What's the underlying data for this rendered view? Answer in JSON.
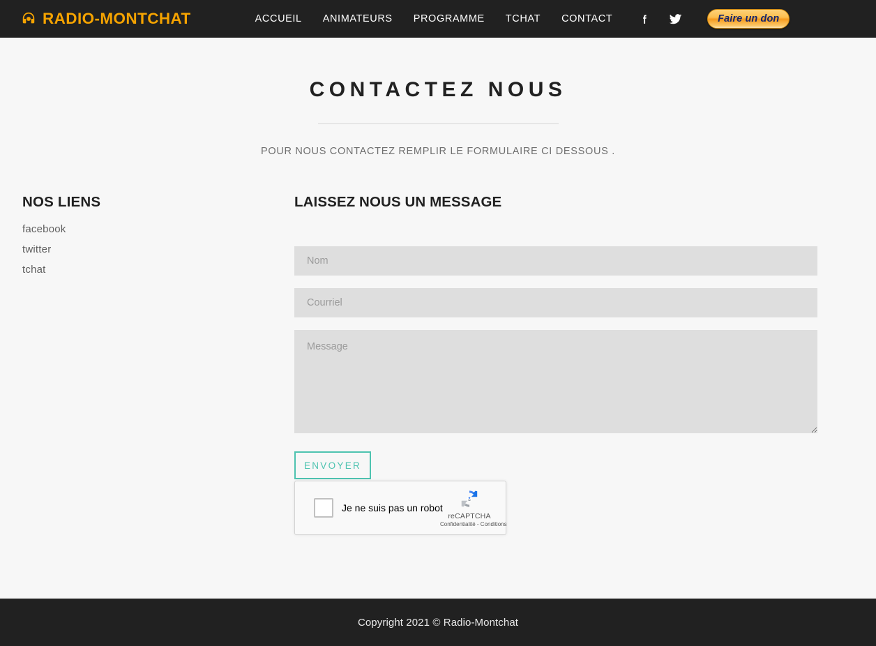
{
  "header": {
    "brand": {
      "icon": "headphones-icon",
      "text": "RADIO-MONTCHAT",
      "color": "#f5a300"
    },
    "nav": [
      {
        "label": "ACCUEIL"
      },
      {
        "label": "ANIMATEURS"
      },
      {
        "label": "PROGRAMME"
      },
      {
        "label": "TCHAT"
      },
      {
        "label": "CONTACT"
      }
    ],
    "social": [
      {
        "name": "facebook-icon"
      },
      {
        "name": "twitter-icon"
      }
    ],
    "donate_label": "Faire un don",
    "background": "#212121"
  },
  "page": {
    "title": "CONTACTEZ NOUS",
    "subtitle": "POUR NOUS CONTACTEZ REMPLIR LE FORMULAIRE CI DESSOUS ."
  },
  "sidebar": {
    "title": "NOS LIENS",
    "links": [
      {
        "label": "facebook"
      },
      {
        "label": "twitter"
      },
      {
        "label": "tchat"
      }
    ]
  },
  "form": {
    "title": "LAISSEZ NOUS UN MESSAGE",
    "name_placeholder": "Nom",
    "name_value": "",
    "email_placeholder": "Courriel",
    "email_value": "",
    "message_placeholder": "Message",
    "message_value": "",
    "submit_label": "ENVOYER",
    "accent_color": "#4ec3b0"
  },
  "recaptcha": {
    "label": "Je ne suis pas un robot",
    "brand": "reCAPTCHA",
    "legal": "Confidentialité - Conditions"
  },
  "footer": {
    "text": "Copyright 2021 © Radio-Montchat"
  }
}
